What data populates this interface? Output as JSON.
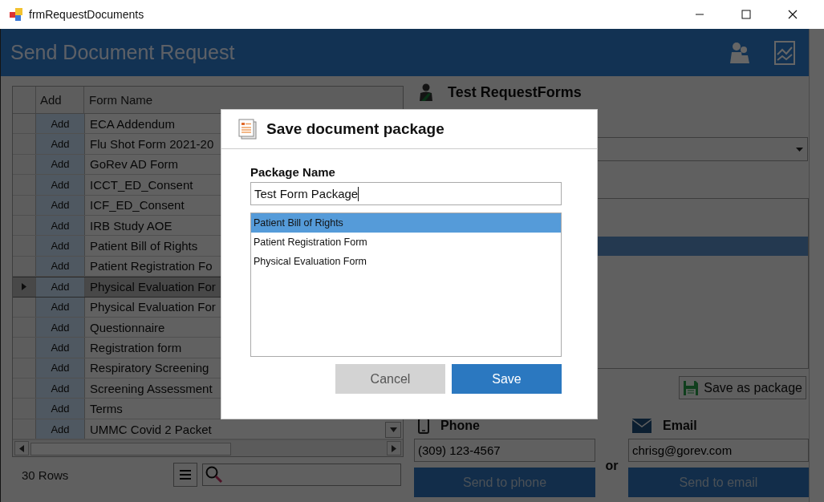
{
  "window": {
    "title": "frmRequestDocuments"
  },
  "header": {
    "title": "Send Document Request"
  },
  "grid": {
    "columns": [
      "Add",
      "Form Name"
    ],
    "rows": [
      {
        "add": "Add",
        "name": "ECA Addendum",
        "current": false
      },
      {
        "add": "Add",
        "name": "Flu Shot Form 2021-20",
        "current": false
      },
      {
        "add": "Add",
        "name": "GoRev AD Form",
        "current": false
      },
      {
        "add": "Add",
        "name": "ICCT_ED_Consent",
        "current": false
      },
      {
        "add": "Add",
        "name": "ICF_ED_Consent",
        "current": false
      },
      {
        "add": "Add",
        "name": "IRB Study AOE",
        "current": false
      },
      {
        "add": "Add",
        "name": "Patient Bill of Rights",
        "current": false
      },
      {
        "add": "Add",
        "name": "Patient Registration Fo",
        "current": false
      },
      {
        "add": "Add",
        "name": "Physical Evaluation For",
        "current": true
      },
      {
        "add": "Add",
        "name": "Physical Evaluation For",
        "current": false
      },
      {
        "add": "Add",
        "name": "Questionnaire",
        "current": false
      },
      {
        "add": "Add",
        "name": "Registration form",
        "current": false
      },
      {
        "add": "Add",
        "name": "Respiratory Screening",
        "current": false
      },
      {
        "add": "Add",
        "name": "Screening Assessment",
        "current": false
      },
      {
        "add": "Add",
        "name": "Terms",
        "current": false
      },
      {
        "add": "Add",
        "name": "UMMC Covid 2 Packet",
        "current": false
      }
    ],
    "row_count": "30 Rows"
  },
  "patient": {
    "name": "Test RequestForms"
  },
  "document_list": {
    "rows": [
      {
        "selected": false
      },
      {
        "selected": false
      },
      {
        "selected": true
      },
      {
        "selected": false
      },
      {
        "selected": false
      },
      {
        "selected": false
      },
      {
        "selected": false
      },
      {
        "selected": false
      }
    ]
  },
  "save_package_button": "Save as package",
  "phone": {
    "label": "Phone",
    "value": "(309) 123-4567",
    "button": "Send to phone"
  },
  "or_label": "or",
  "email": {
    "label": "Email",
    "value": "chrisg@gorev.com",
    "button": "Send to email"
  },
  "dialog": {
    "title": "Save document package",
    "field_label": "Package Name",
    "value": "Test Form Package",
    "items": [
      {
        "label": "Patient Bill of Rights",
        "selected": true
      },
      {
        "label": "Patient Registration Form",
        "selected": false
      },
      {
        "label": "Physical Evaluation Form",
        "selected": false
      }
    ],
    "buttons": [
      {
        "label": "Cancel",
        "kind": "secondary"
      },
      {
        "label": "Save",
        "kind": "primary"
      }
    ]
  }
}
